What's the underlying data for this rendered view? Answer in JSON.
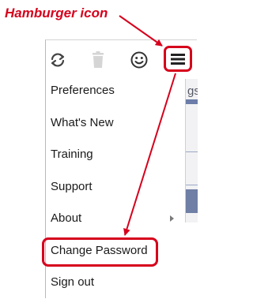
{
  "annotation": {
    "callout_text": "Hamburger icon",
    "color": "#d6001c"
  },
  "toolbar": {
    "buttons": [
      {
        "name": "refresh-icon",
        "enabled": true
      },
      {
        "name": "trash-icon",
        "enabled": false
      },
      {
        "name": "smiley-icon",
        "enabled": true
      },
      {
        "name": "hamburger-menu-icon",
        "enabled": true
      }
    ]
  },
  "background_partial_text": "gs",
  "menu": {
    "items": [
      {
        "label": "Preferences"
      },
      {
        "label": "What's New"
      },
      {
        "label": "Training"
      },
      {
        "label": "Support"
      },
      {
        "label": "About",
        "has_submenu": true
      },
      {
        "label": "Change Password",
        "highlighted": true
      },
      {
        "label": "Sign out"
      }
    ]
  }
}
